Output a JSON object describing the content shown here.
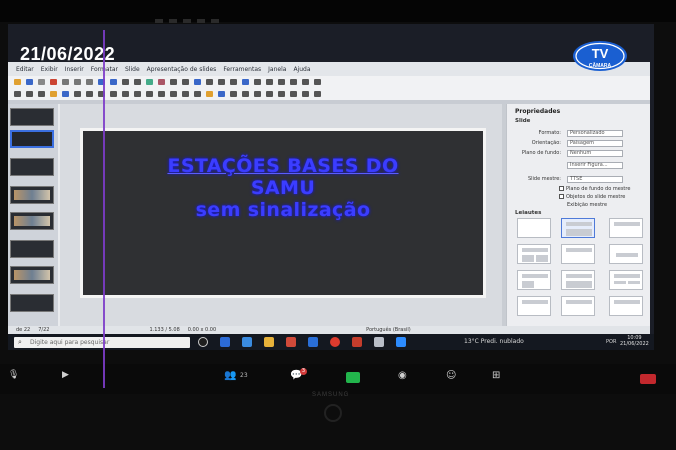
{
  "broadcast": {
    "date": "21/06/2022",
    "logo_top": "TV",
    "logo_bottom": "CÂMARA"
  },
  "app": {
    "menu": [
      "Editar",
      "Exibir",
      "Inserir",
      "Formatar",
      "Slide",
      "Apresentação de slides",
      "Ferramentas",
      "Janela",
      "Ajuda"
    ],
    "slide_text": {
      "line1": "ESTAÇÕES BASES DO",
      "line2": "SAMU",
      "line3": "sem sinalização"
    },
    "slides_count": "de 22",
    "status": {
      "left": "7/22",
      "position": "1.133 / 5.08",
      "size": "0.00 x 0.00",
      "right": "Português (Brasil)"
    },
    "properties": {
      "title": "Propriedades",
      "section_slide": "Slide",
      "rows": [
        {
          "label": "Formato:",
          "value": "Personalizado"
        },
        {
          "label": "Orientação:",
          "value": "Paisagem"
        },
        {
          "label": "Plano de fundo:",
          "value": "Nenhum"
        },
        {
          "label": "",
          "value": "Inserir Figura..."
        },
        {
          "label": "Slide mestre:",
          "value": "TTSE"
        }
      ],
      "checks": [
        "Plano de fundo do mestre",
        "Objetos do slide mestre",
        "Exibição mestre"
      ],
      "section_layouts": "Leiautes"
    }
  },
  "taskbar": {
    "search_placeholder": "Digite aqui para pesquisar",
    "weather": "13°C  Predi. nublado",
    "lang": "POR",
    "time": "10:09",
    "date": "21/06/2022"
  },
  "meeting_bar": {
    "participants": "23",
    "chat_badge": "3"
  },
  "tv_brand": "SAMSUNG"
}
